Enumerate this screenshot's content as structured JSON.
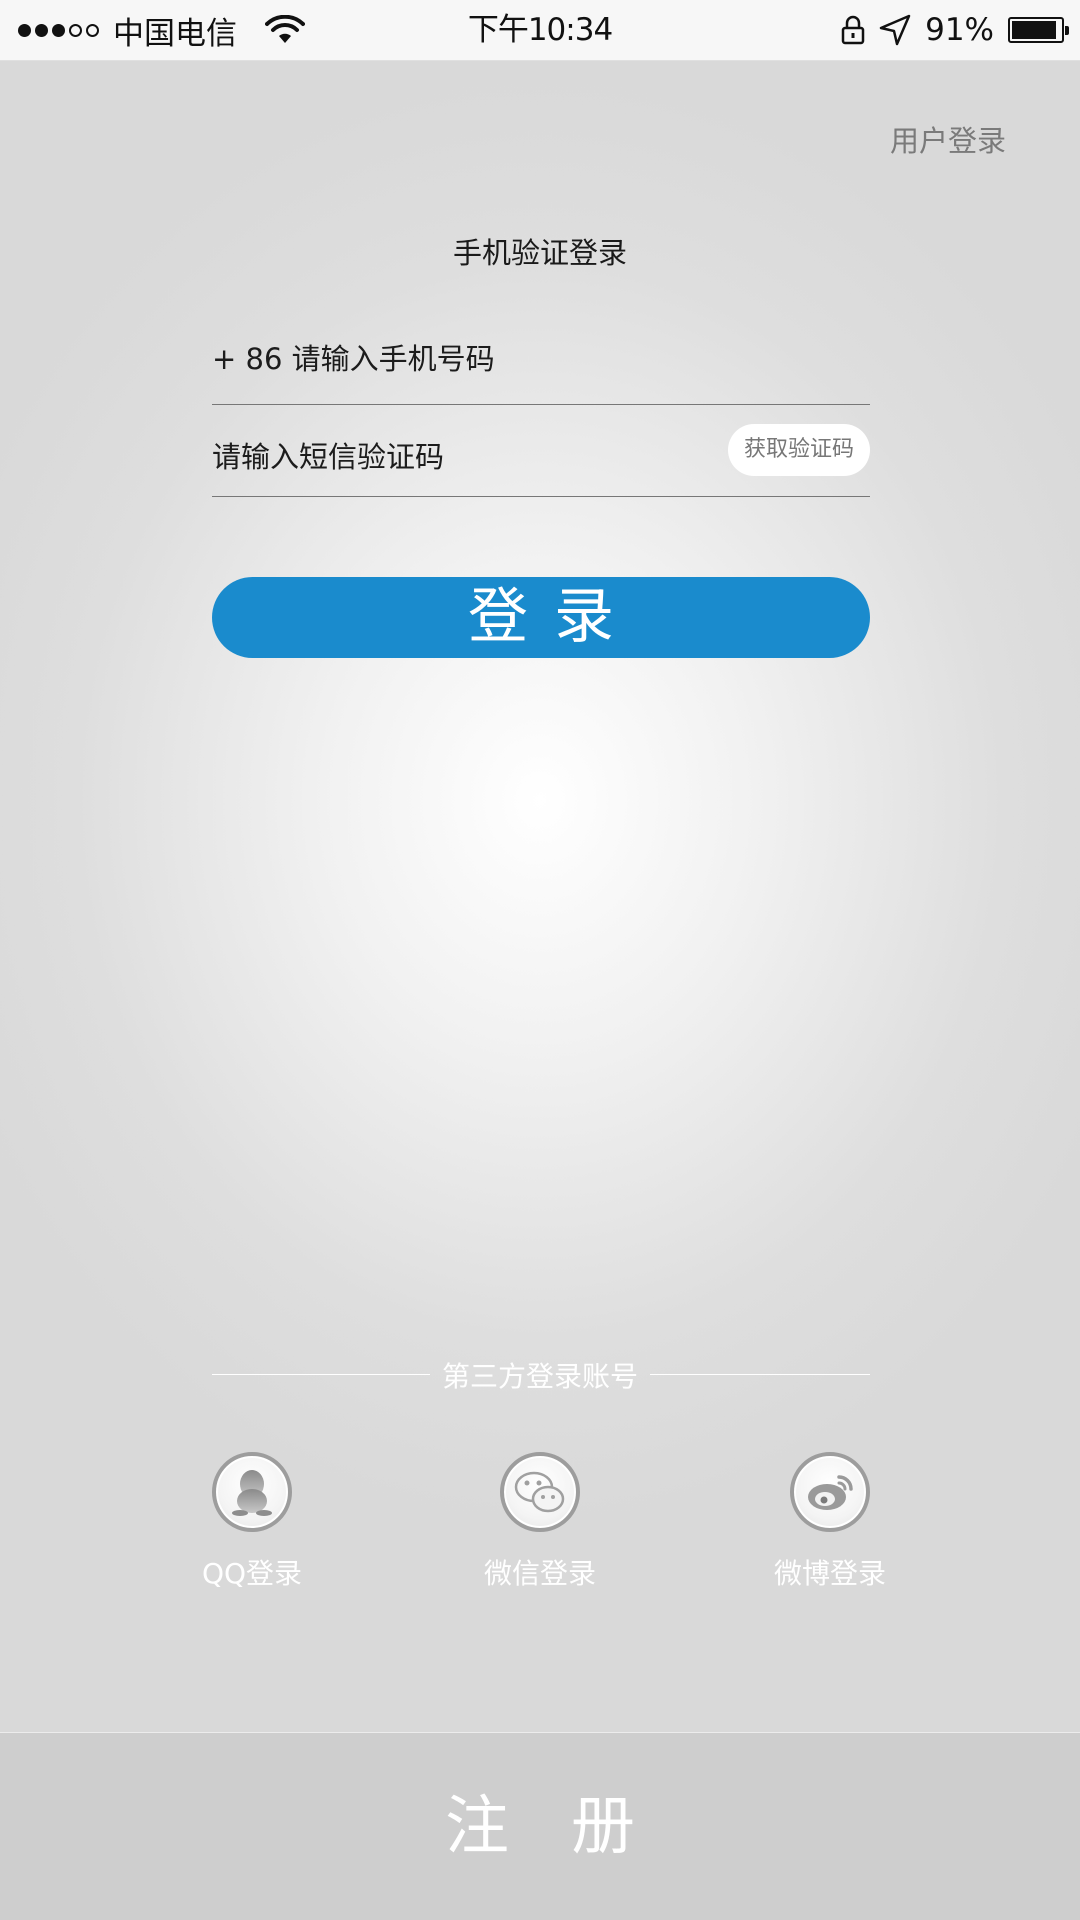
{
  "status_bar": {
    "carrier": "中国电信",
    "time": "下午10:34",
    "battery_percent": "91%",
    "battery_level": 0.91,
    "signal_bars": 3,
    "signal_total": 5,
    "icons": [
      "wifi-icon",
      "lock-icon",
      "location-icon",
      "battery-icon"
    ]
  },
  "header": {
    "user_login_link": "用户登录"
  },
  "form": {
    "title": "手机验证登录",
    "phone_placeholder": "+ 86 请输入手机号码",
    "code_placeholder": "请输入短信验证码",
    "get_code_label": "获取验证码",
    "login_label": "登录"
  },
  "third_party": {
    "label": "第三方登录账号",
    "options": [
      {
        "label": "QQ登录",
        "icon": "qq-icon"
      },
      {
        "label": "微信登录",
        "icon": "wechat-icon"
      },
      {
        "label": "微博登录",
        "icon": "weibo-icon"
      }
    ]
  },
  "register": {
    "label": "注册"
  },
  "colors": {
    "primary": "#1a8bcd",
    "register_bar": "#cecece",
    "icon_gray": "#9d9d9d"
  }
}
